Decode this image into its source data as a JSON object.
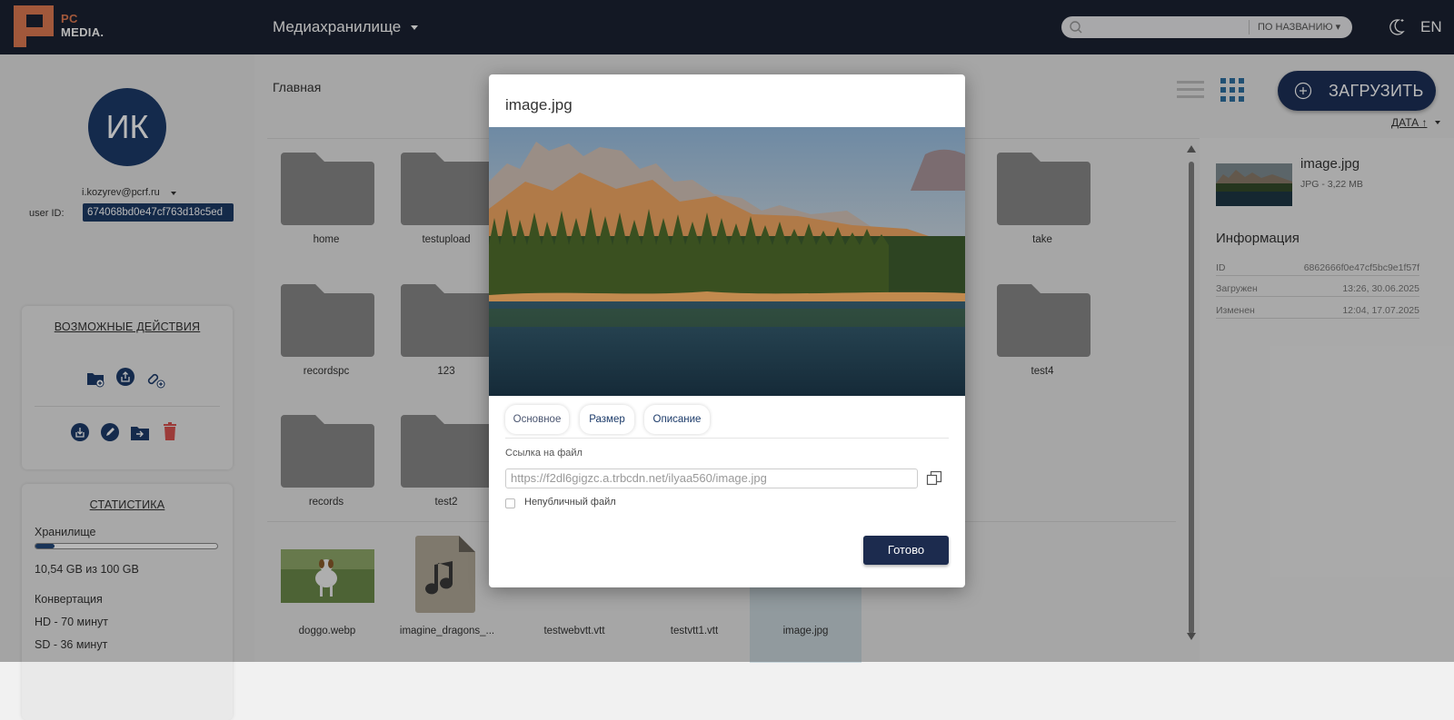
{
  "header": {
    "logo_line1": "PC",
    "logo_line2": "MEDIA.",
    "title": "Медиахранилище",
    "search_placeholder": "",
    "sort_label": "ПО НАЗВАНИЮ",
    "lang": "EN"
  },
  "sidebar": {
    "avatar_initials": "ИК",
    "email": "i.kozyrev@pcrf.ru",
    "user_id_label": "user ID:",
    "user_id": "674068bd0e47cf763d18c5ed",
    "actions_title": "ВОЗМОЖНЫЕ ДЕЙСТВИЯ",
    "stats_title": "СТАТИСТИКА",
    "storage_label": "Хранилище",
    "storage_used_fraction": 0.105,
    "storage_text": "10,54 GB из 100 GB",
    "conversion_label": "Конвертация",
    "hd": "HD - 70 минут",
    "sd": "SD - 36 минут"
  },
  "main": {
    "breadcrumb": "Главная",
    "upload_label": "ЗАГРУЗИТЬ",
    "date_sort": "ДАТА ↑",
    "folders": [
      "home",
      "testupload",
      "take",
      "recordspc",
      "123",
      "test4",
      "records",
      "test2"
    ],
    "files": [
      "doggo.webp",
      "imagine_dragons_...",
      "testwebvtt.vtt",
      "testvtt1.vtt",
      "image.jpg"
    ]
  },
  "details": {
    "name": "image.jpg",
    "meta": "JPG - 3,22 MB",
    "info_title": "Информация",
    "rows": [
      {
        "k": "ID",
        "v": "6862666f0e47cf5bc9e1f57f"
      },
      {
        "k": "Загружен",
        "v": "13:26, 30.06.2025"
      },
      {
        "k": "Изменен",
        "v": "12:04, 17.07.2025"
      }
    ]
  },
  "modal": {
    "title": "image.jpg",
    "tabs": [
      "Основное",
      "Размер",
      "Описание"
    ],
    "link_label": "Ссылка на файл",
    "link_value": "https://f2dl6gigzc.a.trbcdn.net/ilyaa560/image.jpg",
    "private_label": "Непубличный файл",
    "done_label": "Готово"
  },
  "colors": {
    "header_bg": "#1b2233",
    "brand_orange": "#e07b53",
    "accent_blue": "#1c3b6a",
    "delete_red": "#d9534f"
  }
}
